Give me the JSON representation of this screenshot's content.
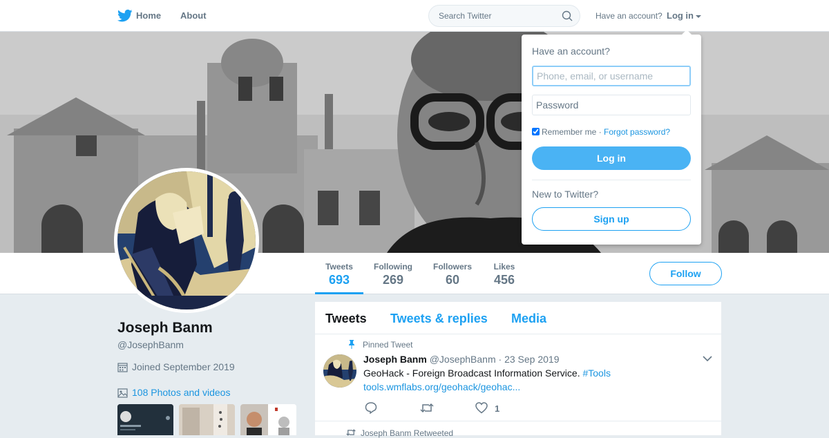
{
  "nav": {
    "home_label": "Home",
    "about_label": "About",
    "search_placeholder": "Search Twitter",
    "have_account_text": "Have an account?",
    "login_label": "Log in"
  },
  "profile": {
    "name": "Joseph Banm",
    "handle": "@JosephBanm",
    "joined": "Joined September 2019",
    "photos_label": "108 Photos and videos"
  },
  "stats": [
    {
      "label": "Tweets",
      "value": "693"
    },
    {
      "label": "Following",
      "value": "269"
    },
    {
      "label": "Followers",
      "value": "60"
    },
    {
      "label": "Likes",
      "value": "456"
    }
  ],
  "follow_label": "Follow",
  "timeline": {
    "tabs": [
      {
        "label": "Tweets"
      },
      {
        "label": "Tweets & replies"
      },
      {
        "label": "Media"
      }
    ],
    "pinned_tweet": {
      "pinned_label": "Pinned Tweet",
      "author": "Joseph Banm",
      "handle": "@JosephBanm",
      "date": "· 23 Sep 2019",
      "text": "GeoHack - Foreign Broadcast Information Service.",
      "hashtag": "#Tools",
      "link": "tools.wmflabs.org/geohack/geohac...",
      "like_count": "1"
    },
    "retweet_label": "Joseph Banm Retweeted"
  },
  "login_dropdown": {
    "title": "Have an account?",
    "username_placeholder": "Phone, email, or username",
    "password_placeholder": "Password",
    "remember_label": "Remember me",
    "separator": " · ",
    "forgot_label": "Forgot password?",
    "login_button": "Log in",
    "new_text": "New to Twitter?",
    "signup_button": "Sign up"
  },
  "colors": {
    "brand": "#1da1f2",
    "login_button": "#4ab3f4",
    "background": "#e6ecf0"
  }
}
